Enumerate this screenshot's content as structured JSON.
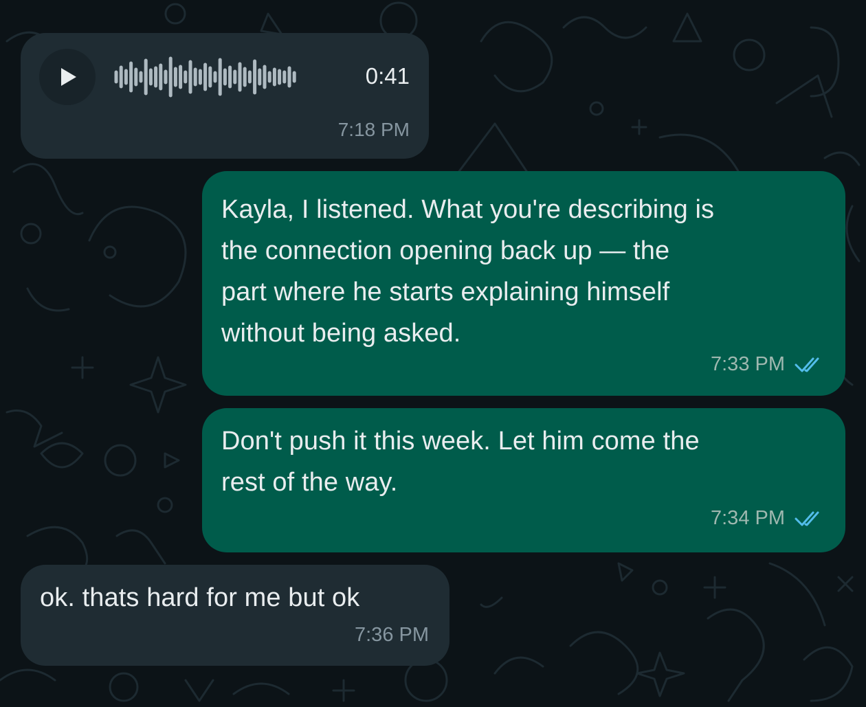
{
  "chat": {
    "voice_message": {
      "duration": "0:41",
      "time": "7:18 PM",
      "progress": 0
    },
    "messages": [
      {
        "direction": "outgoing",
        "text": "Kayla, I listened. What you're describing is\nthe connection opening back up — the\npart where he starts explaining himself\nwithout being asked.",
        "time": "7:33 PM",
        "status": "read"
      },
      {
        "direction": "outgoing",
        "text": "Don't push it this week. Let him come the\nrest of the way.",
        "time": "7:34 PM",
        "status": "read"
      },
      {
        "direction": "incoming",
        "text": "ok. thats hard for me but ok",
        "time": "7:36 PM"
      }
    ]
  },
  "icons": {
    "play": "play-icon",
    "read_receipt": "double-check-icon"
  },
  "colors": {
    "background": "#0c1317",
    "incoming_bubble": "#1f2c33",
    "outgoing_bubble": "#005c4b",
    "read_tick": "#53bdeb",
    "text": "#e9edef",
    "meta_text": "#8696a0"
  }
}
